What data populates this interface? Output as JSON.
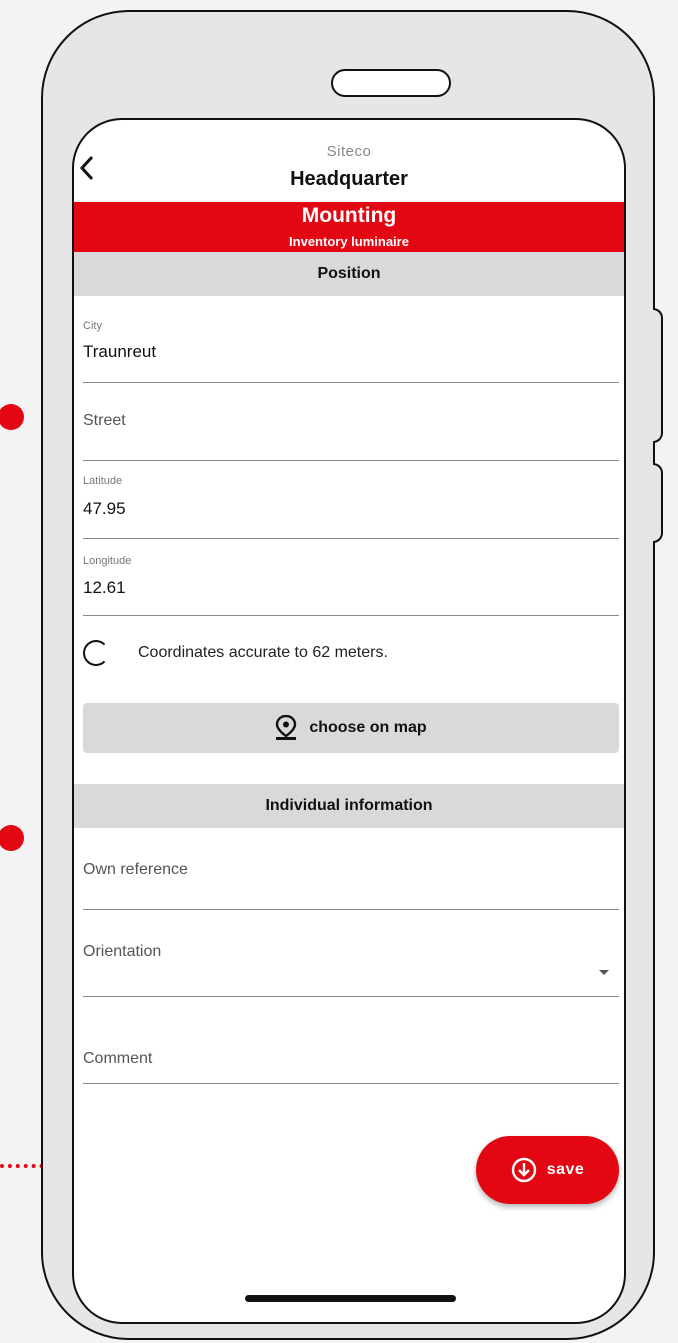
{
  "header": {
    "back_icon": "chevron-left-icon",
    "company": "Siteco",
    "title": "Headquarter"
  },
  "banner": {
    "title": "Mounting",
    "subtitle": "Inventory luminaire",
    "color": "#e30613"
  },
  "position_section": {
    "title": "Position",
    "city": {
      "label": "City",
      "value": "Traunreut"
    },
    "street": {
      "placeholder": "Street"
    },
    "latitude": {
      "label": "Latitude",
      "value": "47.95"
    },
    "longitude": {
      "label": "Longitude",
      "value": "12.61"
    },
    "accuracy_text": "Coordinates accurate to 62 meters.",
    "map_button": {
      "label": "choose on map",
      "icon": "map-pin-icon"
    }
  },
  "individual_section": {
    "title": "Individual information",
    "own_reference": {
      "placeholder": "Own reference"
    },
    "orientation": {
      "placeholder": "Orientation"
    },
    "comment": {
      "placeholder": "Comment"
    }
  },
  "save_button": {
    "label": "save",
    "icon": "download-circle-icon"
  },
  "colors": {
    "accent": "#e30613",
    "section_bg": "#d9d9dc"
  }
}
